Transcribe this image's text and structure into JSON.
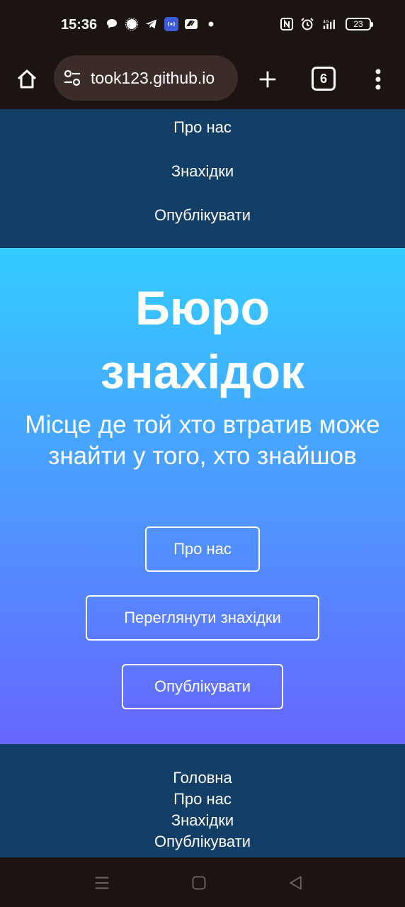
{
  "status_bar": {
    "time": "15:36",
    "battery": "23",
    "icons_left": [
      "chat-bubble-icon",
      "signal-app-icon",
      "telegram-icon",
      "vpn-icon",
      "bank-app-icon",
      "dot-icon"
    ],
    "icons_right": [
      "nfc-icon",
      "alarm-icon",
      "4g-signal-icon",
      "battery-icon"
    ]
  },
  "browser": {
    "url": "took123.github.io",
    "tab_count": "6"
  },
  "top_nav": {
    "items": [
      "Про нас",
      "Знахідки",
      "Опублікувати"
    ]
  },
  "hero": {
    "title_line1": "Бюро",
    "title_line2": "знахідок",
    "subtitle": "Місце де той хто втратив може знайти у того, хто знайшов",
    "buttons": [
      "Про нас",
      "Переглянути знахідки",
      "Опублікувати"
    ]
  },
  "footer": {
    "links": [
      "Головна",
      "Про нас",
      "Знахідки",
      "Опублікувати"
    ]
  },
  "colors": {
    "nav_bg": "#123e67",
    "hero_top": "#33ccff",
    "hero_bottom": "#6666ff",
    "chrome_bg": "#1b1411",
    "url_pill": "#3b2c27"
  }
}
